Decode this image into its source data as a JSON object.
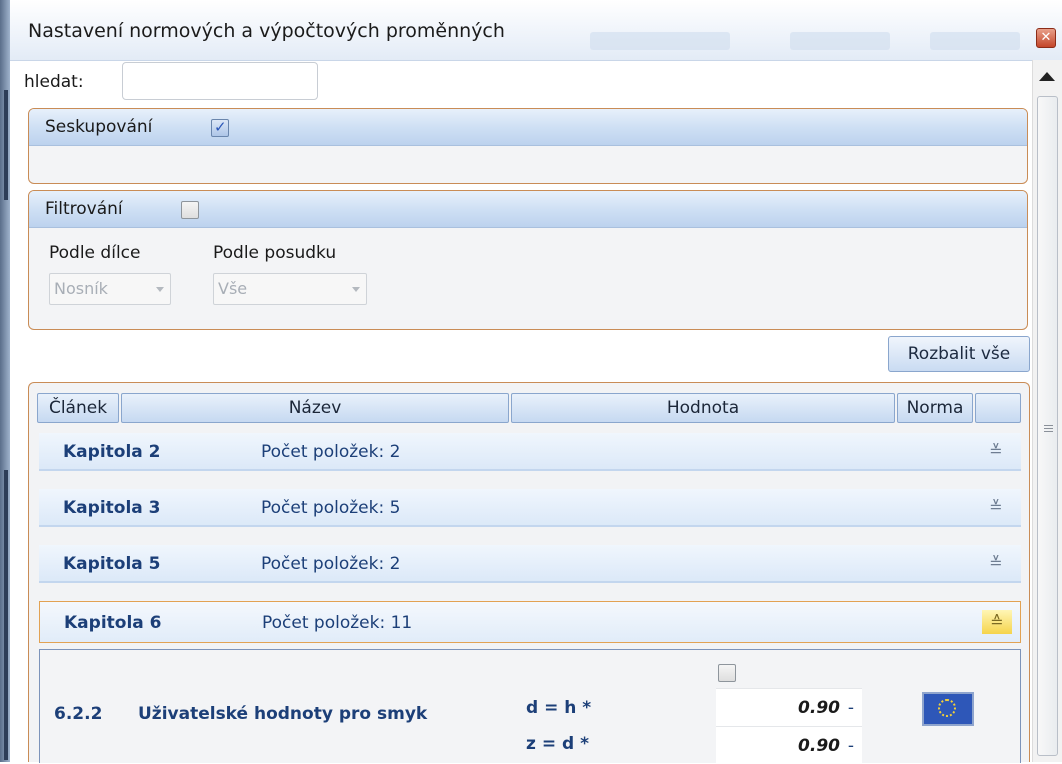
{
  "window": {
    "title": "Nastavení normových a výpočtových proměnných",
    "close_icon": "close-icon"
  },
  "search": {
    "label": "hledat:",
    "value": "",
    "placeholder": ""
  },
  "grouping": {
    "label": "Seskupování",
    "checked": true
  },
  "filtering": {
    "label": "Filtrování",
    "checked": false,
    "by_member": {
      "label": "Podle dílce",
      "value": "Nosník"
    },
    "by_check": {
      "label": "Podle posudku",
      "value": "Vše"
    }
  },
  "toolbar": {
    "expand_all_label": "Rozbalit vše"
  },
  "grid": {
    "columns": [
      "Článek",
      "Název",
      "Hodnota",
      "Norma"
    ],
    "chapters": [
      {
        "name": "Kapitola 2",
        "count": "Počet položek: 2",
        "expanded": false
      },
      {
        "name": "Kapitola 3",
        "count": "Počet položek: 5",
        "expanded": false
      },
      {
        "name": "Kapitola 5",
        "count": "Počet položek: 2",
        "expanded": false
      },
      {
        "name": "Kapitola 6",
        "count": "Počet položek: 11",
        "expanded": true
      }
    ],
    "detail": {
      "section": "6.2.2",
      "title": "Uživatelské hodnoty pro smyk",
      "checked": false,
      "rows": [
        {
          "label": "d = h *",
          "value": "0.90",
          "unit": "-"
        },
        {
          "label": "z = d *",
          "value": "0.90",
          "unit": "-"
        }
      ],
      "norm_icon": "eu-flag-icon"
    }
  },
  "colors": {
    "accent_border": "#c98c56",
    "header_blue": "#cfe0f4",
    "text_blue": "#1c3f78"
  }
}
